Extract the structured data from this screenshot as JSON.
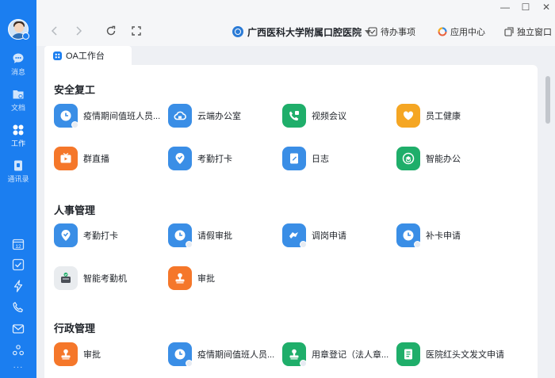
{
  "window": {
    "min_glyph": "—",
    "max_glyph": "☐",
    "close_glyph": "✕"
  },
  "sidebar": {
    "items": [
      {
        "label": "消息",
        "icon": "message-icon"
      },
      {
        "label": "文档",
        "icon": "document-icon"
      },
      {
        "label": "工作",
        "icon": "work-grid-icon",
        "active": true
      },
      {
        "label": "通讯录",
        "icon": "contacts-icon"
      }
    ],
    "tools": [
      {
        "icon": "calendar-icon",
        "text": "12"
      },
      {
        "icon": "todo-check-icon"
      },
      {
        "icon": "lightning-icon"
      },
      {
        "icon": "phone-icon"
      },
      {
        "icon": "mail-icon"
      },
      {
        "icon": "team-icon"
      },
      {
        "icon": "more-icon",
        "text": "···"
      }
    ]
  },
  "topbar": {
    "org_name": "广西医科大学附属口腔医院",
    "todo_label": "待办事项",
    "app_center_label": "应用中心",
    "detach_label": "独立窗口"
  },
  "tab": {
    "label": "OA工作台"
  },
  "sections": [
    {
      "title": "安全复工",
      "apps": [
        {
          "label": "疫情期间值班人员...",
          "color": "#3a8ee6",
          "icon": "clock-icon"
        },
        {
          "label": "云端办公室",
          "color": "#3a8ee6",
          "icon": "cloud-icon"
        },
        {
          "label": "视频会议",
          "color": "#1fae6a",
          "icon": "video-call-icon"
        },
        {
          "label": "员工健康",
          "color": "#f5a623",
          "icon": "heart-icon"
        },
        {
          "label": "群直播",
          "color": "#f5772a",
          "icon": "live-tv-icon"
        },
        {
          "label": "考勤打卡",
          "color": "#3a8ee6",
          "icon": "location-check-icon"
        },
        {
          "label": "日志",
          "color": "#3a8ee6",
          "icon": "log-book-icon"
        },
        {
          "label": "智能办公",
          "color": "#1fae6a",
          "icon": "smart-office-icon"
        }
      ]
    },
    {
      "title": "人事管理",
      "apps": [
        {
          "label": "考勤打卡",
          "color": "#3a8ee6",
          "icon": "location-check-icon"
        },
        {
          "label": "请假审批",
          "color": "#3a8ee6",
          "icon": "clock-icon"
        },
        {
          "label": "调岗申请",
          "color": "#3a8ee6",
          "icon": "transfer-icon"
        },
        {
          "label": "补卡申请",
          "color": "#3a8ee6",
          "icon": "clock-icon"
        },
        {
          "label": "智能考勤机",
          "color": "#e9ecef",
          "icon": "attendance-machine-icon"
        },
        {
          "label": "审批",
          "color": "#f5772a",
          "icon": "stamp-icon"
        }
      ]
    },
    {
      "title": "行政管理",
      "apps": [
        {
          "label": "审批",
          "color": "#f5772a",
          "icon": "stamp-icon"
        },
        {
          "label": "疫情期间值班人员...",
          "color": "#3a8ee6",
          "icon": "clock-icon"
        },
        {
          "label": "用章登记（法人章...",
          "color": "#1fae6a",
          "icon": "seal-icon"
        },
        {
          "label": "医院红头文发文申请",
          "color": "#1fae6a",
          "icon": "document-file-icon"
        }
      ]
    }
  ]
}
